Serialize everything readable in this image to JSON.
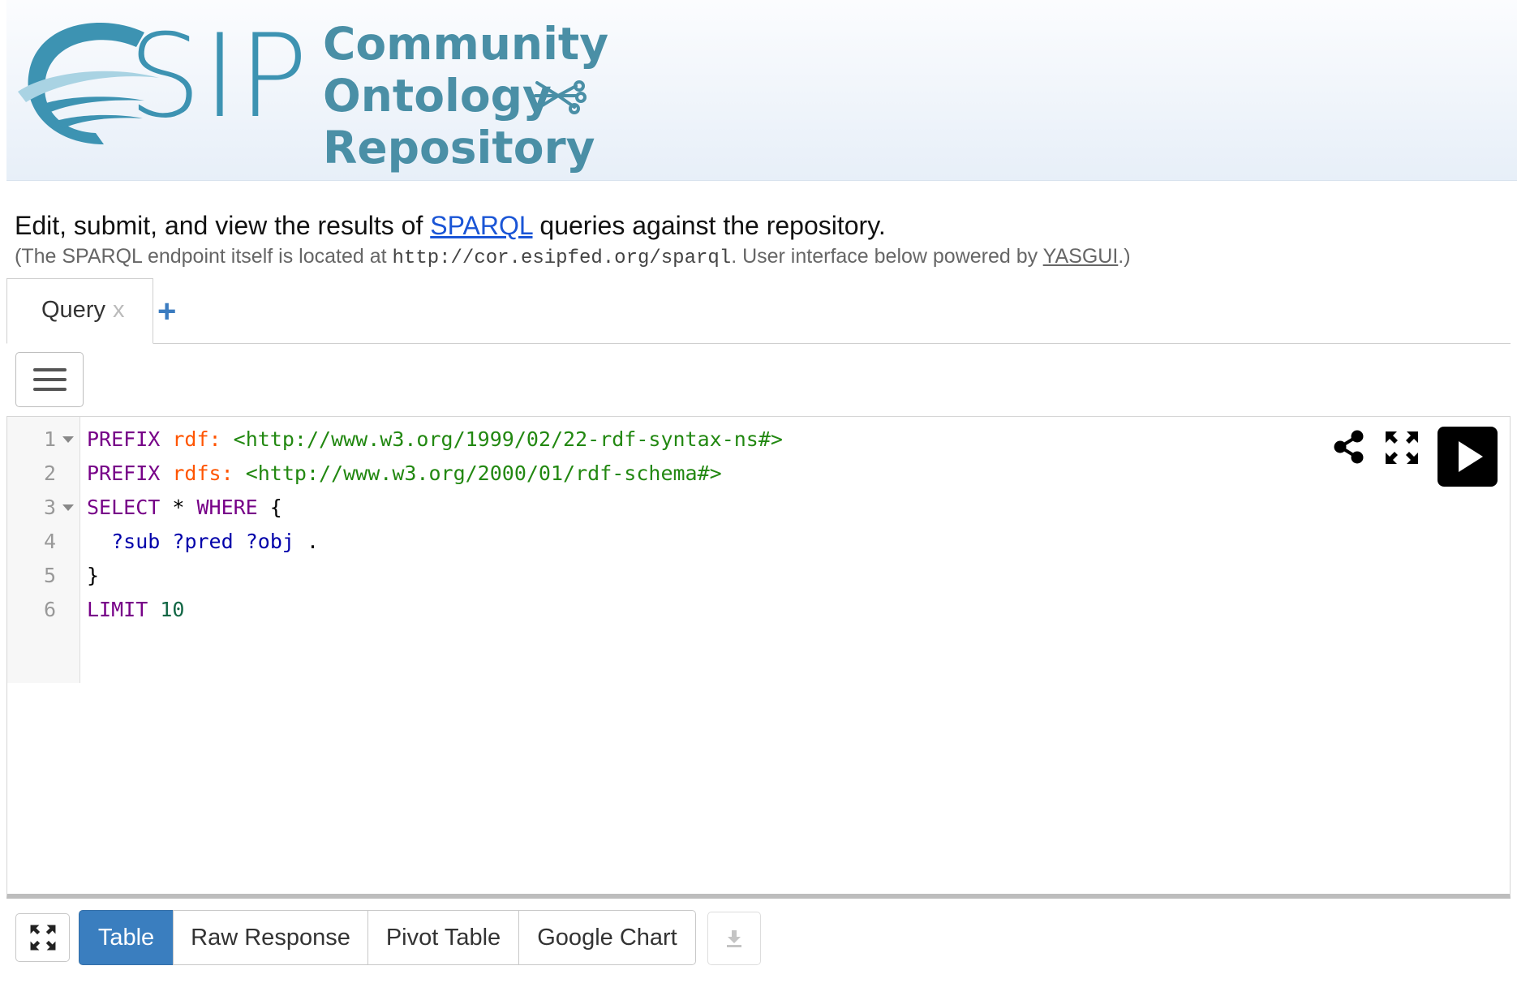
{
  "header": {
    "logo_letters": "SIP",
    "title_lines": [
      "Community",
      "Ontology",
      "Repository"
    ],
    "colors": {
      "logo_blue": "#3d93b2",
      "title_blue": "#4a8fa6",
      "banner_bottom": "#e7eff8"
    }
  },
  "intro": {
    "line1_before": "Edit, submit, and view the results of ",
    "line1_link": "SPARQL",
    "line1_after": " queries against the repository.",
    "line2_before": "(The SPARQL endpoint itself is located at ",
    "line2_code": "http://cor.esipfed.org/sparql",
    "line2_middle": ". User interface below powered by ",
    "line2_link": "YASGUI",
    "line2_after": ".)"
  },
  "tabs": {
    "items": [
      {
        "label": "Query",
        "close": "x"
      }
    ],
    "add_label": "+"
  },
  "editor": {
    "lines": [
      {
        "n": "1",
        "fold": true,
        "tokens": [
          [
            "kw",
            "PREFIX"
          ],
          [
            "pun",
            " "
          ],
          [
            "pfx",
            "rdf:"
          ],
          [
            "pun",
            " "
          ],
          [
            "iri",
            "<http://www.w3.org/1999/02/22-rdf-syntax-ns#>"
          ]
        ]
      },
      {
        "n": "2",
        "fold": false,
        "tokens": [
          [
            "kw",
            "PREFIX"
          ],
          [
            "pun",
            " "
          ],
          [
            "pfx",
            "rdfs:"
          ],
          [
            "pun",
            " "
          ],
          [
            "iri",
            "<http://www.w3.org/2000/01/rdf-schema#>"
          ]
        ]
      },
      {
        "n": "3",
        "fold": true,
        "tokens": [
          [
            "kw",
            "SELECT"
          ],
          [
            "pun",
            " * "
          ],
          [
            "kw",
            "WHERE"
          ],
          [
            "pun",
            " {"
          ]
        ]
      },
      {
        "n": "4",
        "fold": false,
        "tokens": [
          [
            "pun",
            "  "
          ],
          [
            "var",
            "?sub"
          ],
          [
            "pun",
            " "
          ],
          [
            "var",
            "?pred"
          ],
          [
            "pun",
            " "
          ],
          [
            "var",
            "?obj"
          ],
          [
            "pun",
            " ."
          ]
        ]
      },
      {
        "n": "5",
        "fold": false,
        "tokens": [
          [
            "pun",
            "}"
          ]
        ]
      },
      {
        "n": "6",
        "fold": false,
        "tokens": [
          [
            "kw",
            "LIMIT"
          ],
          [
            "pun",
            " "
          ],
          [
            "num",
            "10"
          ]
        ]
      }
    ],
    "token_colors": {
      "kw": "#770088",
      "pfx": "#ff5500",
      "iri": "#228811",
      "var": "#0000aa",
      "num": "#116644"
    },
    "tools": {
      "share_icon": "share-icon",
      "fullscreen_icon": "fullscreen-icon",
      "run_icon": "play-icon"
    }
  },
  "results_toolbar": {
    "expand_icon": "expand-icon",
    "tabs": [
      "Table",
      "Raw Response",
      "Pivot Table",
      "Google Chart"
    ],
    "active": "Table",
    "download_icon": "download-icon",
    "accent": "#3a7ebf"
  }
}
